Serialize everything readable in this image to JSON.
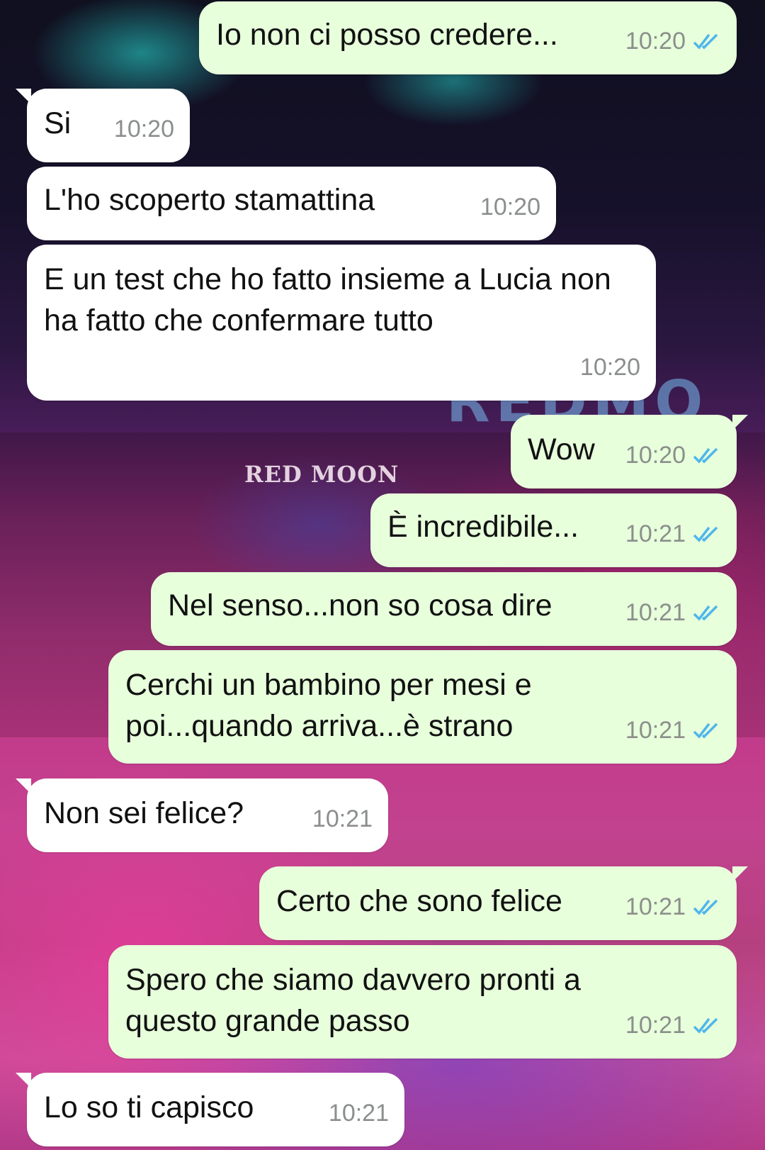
{
  "background": {
    "sign_small": "RED MOON",
    "sign_large": "REDMO"
  },
  "colors": {
    "incoming_bubble": "#ffffff",
    "outgoing_bubble": "#e7ffdb",
    "read_ticks": "#4fb6ec",
    "timestamp": "#8b8f8c"
  },
  "messages": [
    {
      "direction": "out",
      "text": "Io non ci posso credere...",
      "time": "10:20",
      "status": "read-ticks-icon"
    },
    {
      "direction": "in",
      "text": "Si",
      "time": "10:20"
    },
    {
      "direction": "in",
      "text": "L'ho scoperto stamattina",
      "time": "10:20"
    },
    {
      "direction": "in",
      "text": "E un test che ho fatto insieme a Lucia non ha fatto che confermare tutto",
      "time": "10:20"
    },
    {
      "direction": "out",
      "text": "Wow",
      "time": "10:20",
      "status": "read-ticks-icon"
    },
    {
      "direction": "out",
      "text": "È incredibile...",
      "time": "10:21",
      "status": "read-ticks-icon"
    },
    {
      "direction": "out",
      "text": "Nel senso...non so cosa dire",
      "time": "10:21",
      "status": "read-ticks-icon"
    },
    {
      "direction": "out",
      "text": "Cerchi un bambino per mesi e poi...quando arriva...è strano",
      "time": "10:21",
      "status": "read-ticks-icon"
    },
    {
      "direction": "in",
      "text": "Non sei felice?",
      "time": "10:21"
    },
    {
      "direction": "out",
      "text": "Certo che sono felice",
      "time": "10:21",
      "status": "read-ticks-icon"
    },
    {
      "direction": "out",
      "text": "Spero che siamo davvero pronti a questo grande passo",
      "time": "10:21",
      "status": "read-ticks-icon"
    },
    {
      "direction": "in",
      "text": "Lo so ti capisco",
      "time": "10:21"
    }
  ]
}
